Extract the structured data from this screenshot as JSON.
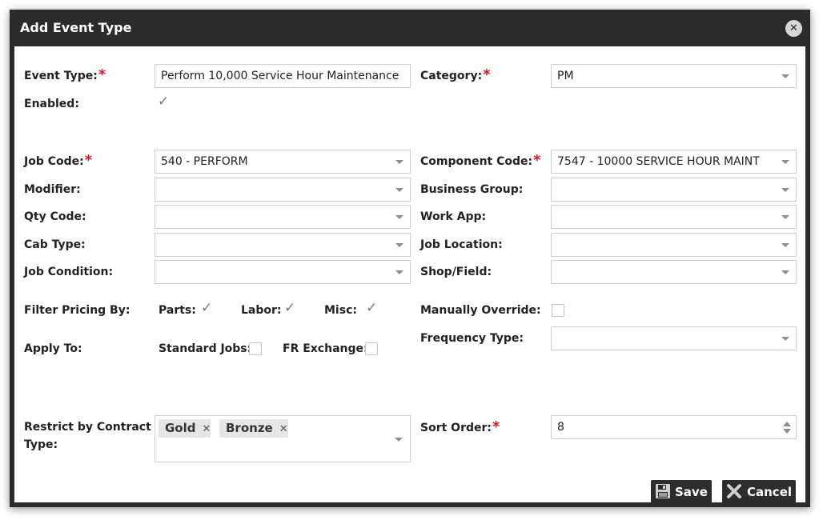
{
  "dialog": {
    "title": "Add Event Type",
    "close_glyph": "✕"
  },
  "required_marker": "*",
  "fields": {
    "event_type": {
      "label": "Event Type:",
      "value": "Perform 10,000 Service Hour Maintenance"
    },
    "category": {
      "label": "Category:",
      "value": "PM"
    },
    "enabled": {
      "label": "Enabled:",
      "checked": true
    },
    "job_code": {
      "label": "Job Code:",
      "value": "540 - PERFORM"
    },
    "component_code": {
      "label": "Component Code:",
      "value": "7547 - 10000 SERVICE HOUR MAINT"
    },
    "modifier": {
      "label": "Modifier:",
      "value": ""
    },
    "business_group": {
      "label": "Business Group:",
      "value": ""
    },
    "qty_code": {
      "label": "Qty Code:",
      "value": ""
    },
    "work_app": {
      "label": "Work App:",
      "value": ""
    },
    "cab_type": {
      "label": "Cab Type:",
      "value": ""
    },
    "job_location": {
      "label": "Job Location:",
      "value": ""
    },
    "job_condition": {
      "label": "Job Condition:",
      "value": ""
    },
    "shop_field": {
      "label": "Shop/Field:",
      "value": ""
    },
    "filter_pricing": {
      "label": "Filter Pricing By:",
      "parts": {
        "label": "Parts:",
        "checked": true
      },
      "labor": {
        "label": "Labor:",
        "checked": true
      },
      "misc": {
        "label": "Misc:",
        "checked": true
      }
    },
    "manually_override": {
      "label": "Manually Override:",
      "checked": false
    },
    "apply_to": {
      "label": "Apply To:",
      "standard_jobs": {
        "label": "Standard Jobs:",
        "checked": false
      },
      "fr_exchange": {
        "label": "FR Exchange:",
        "checked": false
      }
    },
    "frequency_type": {
      "label": "Frequency Type:",
      "value": ""
    },
    "restrict_contract": {
      "label_line1": "Restrict by Contract",
      "label_line2": "Type:",
      "tags": [
        "Gold",
        "Bronze"
      ],
      "remove_glyph": "✕"
    },
    "sort_order": {
      "label": "Sort Order:",
      "value": "8"
    }
  },
  "buttons": {
    "save": "Save",
    "cancel": "Cancel"
  },
  "icons": {
    "close": "close-icon",
    "caret": "chevron-down-icon",
    "check": "checkmark-icon",
    "save": "floppy-disk-icon",
    "cancel": "x-icon"
  }
}
